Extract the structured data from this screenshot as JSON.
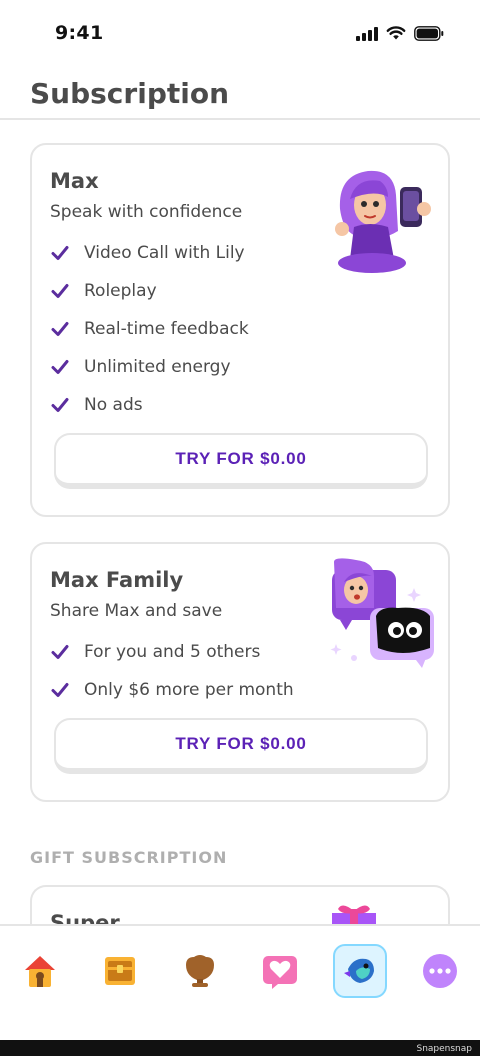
{
  "status_bar": {
    "time": "9:41"
  },
  "header": {
    "title": "Subscription"
  },
  "plans": [
    {
      "title": "Max",
      "subtitle": "Speak with confidence",
      "features": [
        "Video Call with Lily",
        "Roleplay",
        "Real-time feedback",
        "Unlimited energy",
        "No ads"
      ],
      "button_label": "TRY FOR $0.00"
    },
    {
      "title": "Max Family",
      "subtitle": "Share Max and save",
      "features": [
        "For you and 5 others",
        "Only $6 more per month"
      ],
      "button_label": "TRY FOR $0.00"
    }
  ],
  "gift_section": {
    "label": "GIFT SUBSCRIPTION",
    "partial_card_title": "Super"
  },
  "bottom_nav": [
    {
      "name": "home",
      "icon": "house-icon",
      "active": false
    },
    {
      "name": "chest",
      "icon": "treasure-chest-icon",
      "active": false
    },
    {
      "name": "leagues",
      "icon": "trophy-icon",
      "active": false
    },
    {
      "name": "health",
      "icon": "heart-icon",
      "active": false
    },
    {
      "name": "subscription",
      "icon": "duo-bird-icon",
      "active": true
    },
    {
      "name": "more",
      "icon": "more-dots-icon",
      "active": false
    }
  ],
  "watermark": "Snapensnap",
  "colors": {
    "accent_purple": "#5b21b6",
    "check_purple": "#5b2d9e",
    "border": "#e5e5e5",
    "muted": "#afafaf"
  }
}
